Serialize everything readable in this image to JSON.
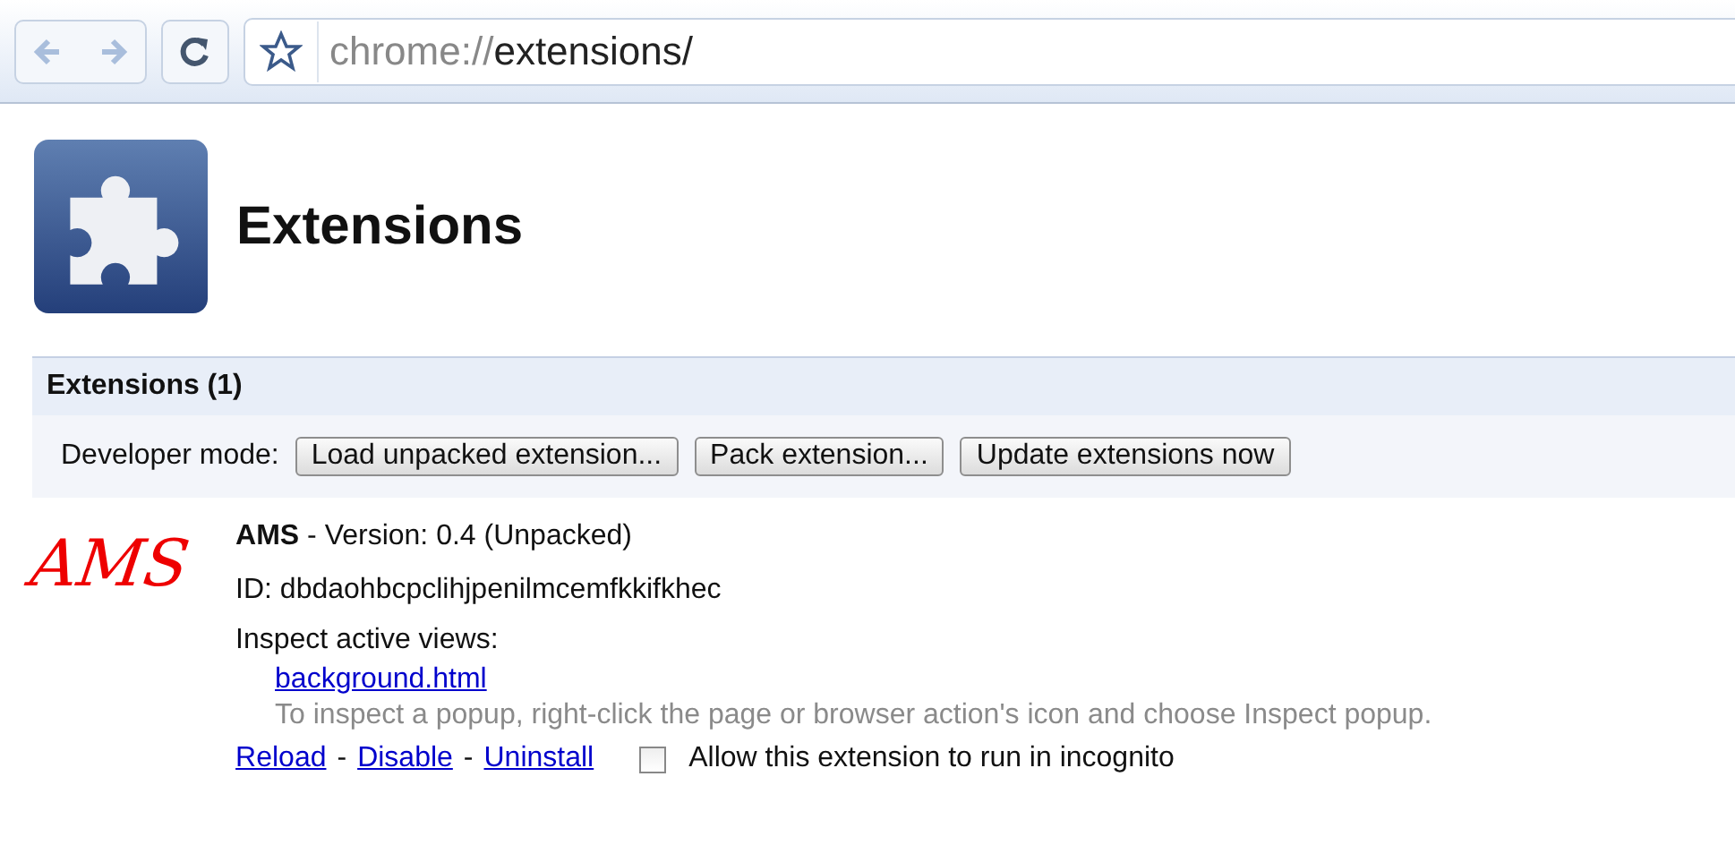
{
  "address_bar": {
    "scheme": "chrome://",
    "path": "extensions/"
  },
  "page_title": "Extensions",
  "section": {
    "title": "Extensions (1)",
    "developer_label": "Developer mode:",
    "buttons": [
      "Load unpacked extension...",
      "Pack extension...",
      "Update extensions now"
    ]
  },
  "extensions": [
    {
      "logo": "AMS",
      "name": "AMS",
      "version": " - Version: 0.4 (Unpacked)",
      "id": "ID: dbdaohbcpclihjpenilmcemfkkifkhec",
      "inspect_label": "Inspect active views:",
      "views": [
        "background.html"
      ],
      "hint": "To inspect a popup, right-click the page or browser action's icon and choose Inspect popup.",
      "actions": [
        "Reload",
        "Disable",
        "Uninstall"
      ],
      "separator": "-",
      "incognito": {
        "label": "Allow this extension to run in incognito",
        "checked": false
      }
    }
  ]
}
